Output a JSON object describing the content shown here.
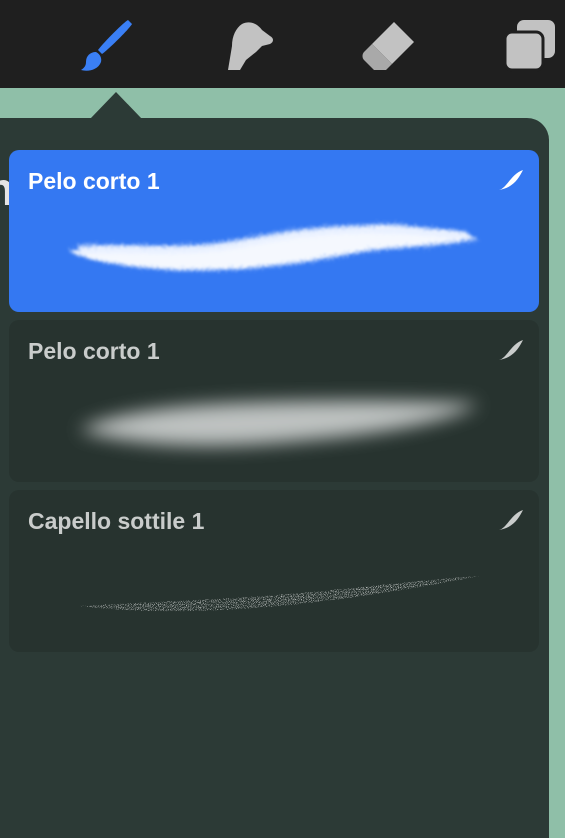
{
  "toolbar": {
    "tools": [
      {
        "name": "brush",
        "icon": "paintbrush-icon",
        "active": true,
        "color": "#3a7ff5"
      },
      {
        "name": "smudge",
        "icon": "smudge-finger-icon",
        "active": false,
        "color": "#c2c2c2"
      },
      {
        "name": "eraser",
        "icon": "eraser-icon",
        "active": false,
        "color": "#c2c2c2"
      },
      {
        "name": "layers",
        "icon": "layers-icon",
        "active": false,
        "color": "#c2c2c2"
      }
    ]
  },
  "panel": {
    "title": "nelli",
    "add_icon": "plus-icon"
  },
  "brushes": [
    {
      "name": "Pelo corto 1",
      "selected": true,
      "pressure_icon": "stylus-pressure-icon"
    },
    {
      "name": "Pelo corto 1",
      "selected": false,
      "pressure_icon": "stylus-pressure-icon"
    },
    {
      "name": "Capello sottile 1",
      "selected": false,
      "pressure_icon": "stylus-pressure-icon"
    }
  ],
  "colors": {
    "accent": "#3478f2",
    "panel": "#2c3a36",
    "canvas": "#8fbfa8",
    "toolbar": "#1f1f1f"
  }
}
